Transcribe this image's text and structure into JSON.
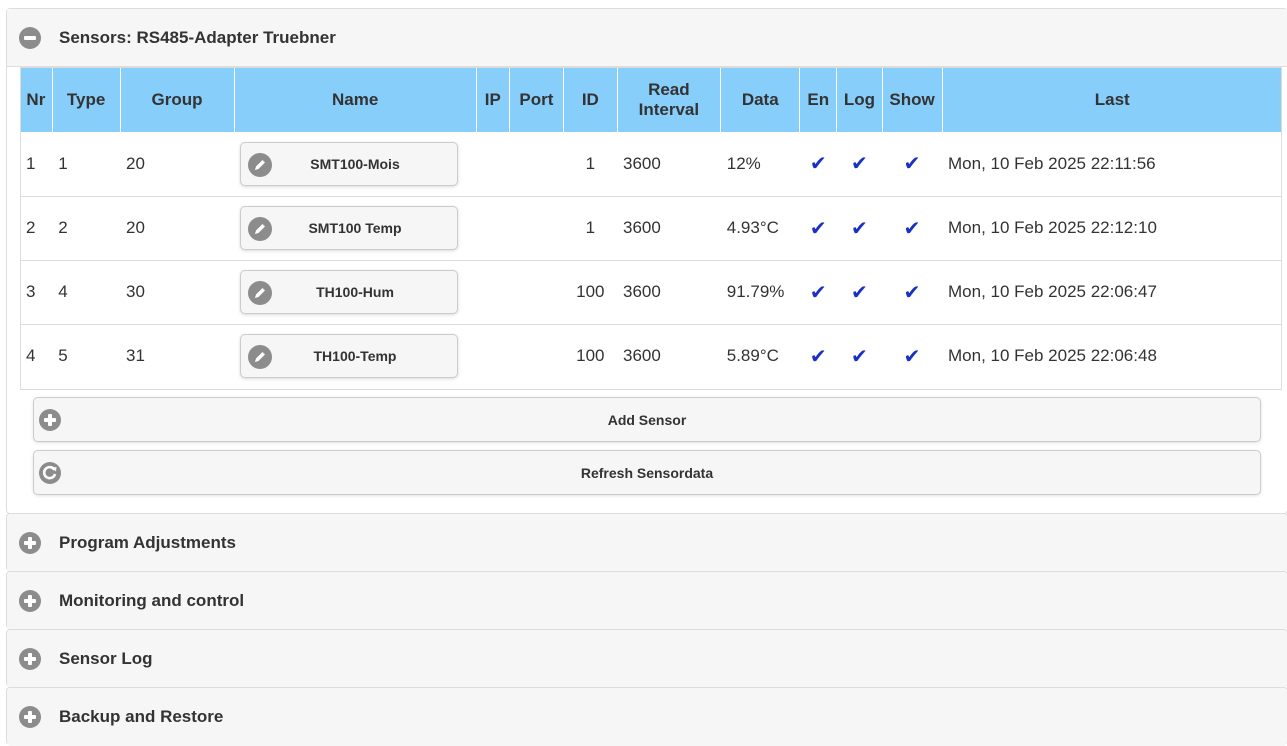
{
  "sensors_panel": {
    "title": "Sensors: RS485-Adapter Truebner",
    "columns": [
      "Nr",
      "Type",
      "Group",
      "Name",
      "IP",
      "Port",
      "ID",
      "Read Interval",
      "Data",
      "En",
      "Log",
      "Show",
      "Last"
    ],
    "read_interval_line1": "Read",
    "read_interval_line2": "Interval",
    "rows": [
      {
        "nr": "1",
        "type": "1",
        "group": "20",
        "name": "SMT100-Mois",
        "ip": "",
        "port": "",
        "id": "1",
        "interval": "3600",
        "data": "12%",
        "en": "✔",
        "log": "✔",
        "show": "✔",
        "last": "Mon, 10 Feb 2025 22:11:56"
      },
      {
        "nr": "2",
        "type": "2",
        "group": "20",
        "name": "SMT100 Temp",
        "ip": "",
        "port": "",
        "id": "1",
        "interval": "3600",
        "data": "4.93°C",
        "en": "✔",
        "log": "✔",
        "show": "✔",
        "last": "Mon, 10 Feb 2025 22:12:10"
      },
      {
        "nr": "3",
        "type": "4",
        "group": "30",
        "name": "TH100-Hum",
        "ip": "",
        "port": "",
        "id": "100",
        "interval": "3600",
        "data": "91.79%",
        "en": "✔",
        "log": "✔",
        "show": "✔",
        "last": "Mon, 10 Feb 2025 22:06:47"
      },
      {
        "nr": "4",
        "type": "5",
        "group": "31",
        "name": "TH100-Temp",
        "ip": "",
        "port": "",
        "id": "100",
        "interval": "3600",
        "data": "5.89°C",
        "en": "✔",
        "log": "✔",
        "show": "✔",
        "last": "Mon, 10 Feb 2025 22:06:48"
      }
    ],
    "add_sensor_label": "Add Sensor",
    "refresh_label": "Refresh Sensordata"
  },
  "sections": [
    {
      "title": "Program Adjustments"
    },
    {
      "title": "Monitoring and control"
    },
    {
      "title": "Sensor Log"
    },
    {
      "title": "Backup and Restore"
    }
  ],
  "colors": {
    "header_bg": "#87cefa",
    "check": "#1a2fc4",
    "icon_grey": "#8c8c8c",
    "panel_bg": "#f6f6f6"
  },
  "icons": {
    "collapse": "minus-circle-icon",
    "expand": "plus-circle-icon",
    "edit": "pencil-icon",
    "add": "plus-circle-icon",
    "refresh": "refresh-icon",
    "check": "checkmark-icon"
  }
}
